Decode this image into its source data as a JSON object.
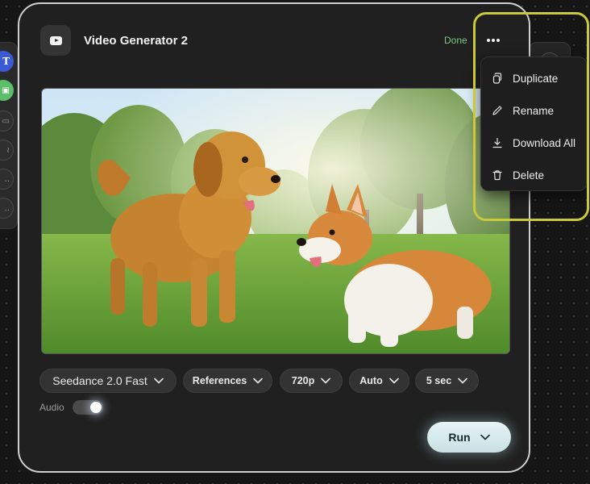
{
  "side_toolbar": {
    "text_tool_glyph": "T"
  },
  "node": {
    "title": "Video Generator 2",
    "status": "Done",
    "icon": "video-play-icon"
  },
  "preview": {
    "description_icon": "video-thumbnail"
  },
  "settings": {
    "model": "Seedance 2.0 Fast",
    "references": "References",
    "resolution": "720p",
    "aspect": "Auto",
    "duration": "5 sec",
    "audio_label": "Audio",
    "audio_enabled": true
  },
  "run_button": {
    "label": "Run"
  },
  "menu": {
    "items": [
      {
        "label": "Duplicate",
        "icon": "duplicate-icon"
      },
      {
        "label": "Rename",
        "icon": "pencil-icon"
      },
      {
        "label": "Download All",
        "icon": "download-icon"
      },
      {
        "label": "Delete",
        "icon": "trash-icon"
      }
    ]
  },
  "colors": {
    "status_done": "#79c77d",
    "highlight": "#c9c93a",
    "run_button": "#d6ebee"
  }
}
